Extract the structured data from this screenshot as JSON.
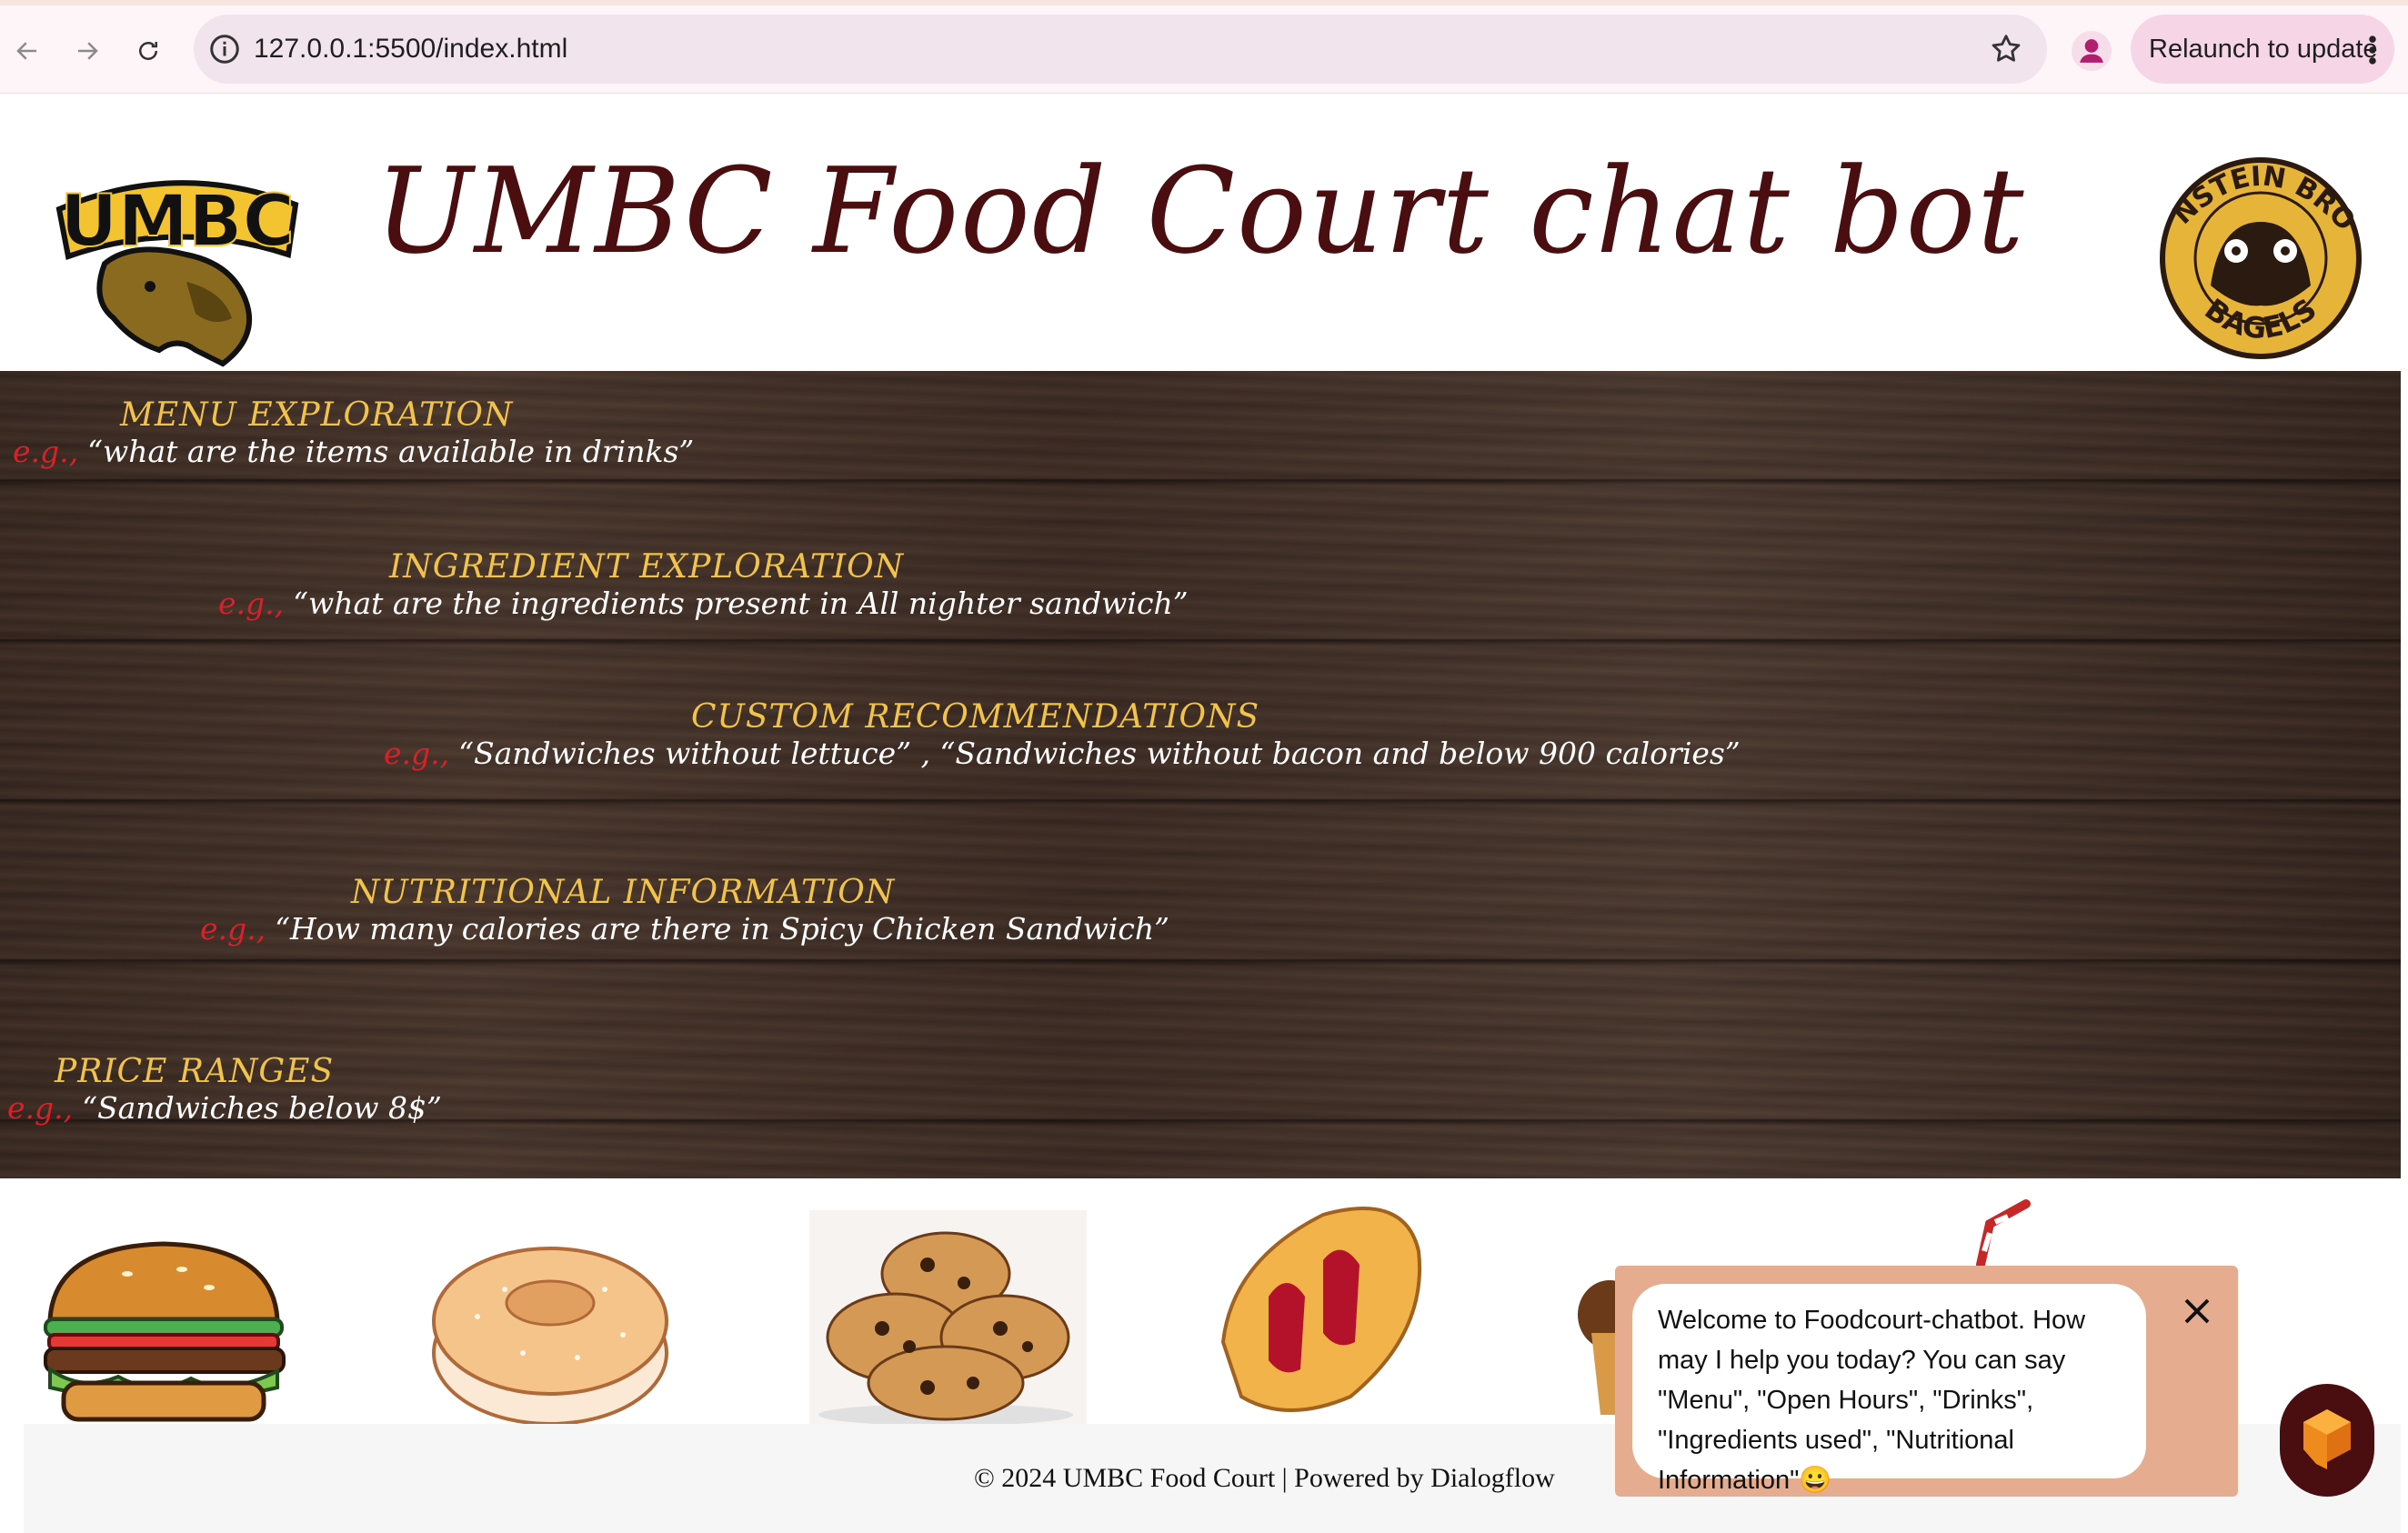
{
  "browser": {
    "url": "127.0.0.1:5500/index.html",
    "relaunch_label": "Relaunch to update",
    "icons": [
      "back-icon",
      "forward-icon",
      "reload-icon",
      "info-icon",
      "star-icon",
      "profile-icon",
      "kebab-menu-icon"
    ]
  },
  "header": {
    "title": "UMBC Food Court chat bot",
    "left_logo_text": "UMBC",
    "right_logo_text_top": "EINSTEIN BROS",
    "right_logo_text_bottom": "BAGELS"
  },
  "features": [
    {
      "title": "MENU EXPLORATION",
      "eg": "e.g.,",
      "example": "“what are the items available in drinks”"
    },
    {
      "title": "INGREDIENT EXPLORATION",
      "eg": "e.g.,",
      "example": "“what are the ingredients present in All nighter sandwich”"
    },
    {
      "title": "CUSTOM RECOMMENDATIONS",
      "eg": "e.g.,",
      "example": "“Sandwiches without lettuce” , “Sandwiches without bacon and below 900 calories”"
    },
    {
      "title": "NUTRITIONAL INFORMATION",
      "eg": "e.g.,",
      "example": "“How many calories are there in Spicy Chicken Sandwich”"
    },
    {
      "title": "PRICE RANGES",
      "eg": "e.g.,",
      "example": "“Sandwiches below 8$”"
    }
  ],
  "foods": [
    "burger-image",
    "bagel-image",
    "cookies-image",
    "pastry-image",
    "muffin-image",
    "drink-straw-image"
  ],
  "footer": {
    "text": "© 2024 UMBC Food Court | Powered by Dialogflow"
  },
  "chat": {
    "message": "Welcome to Foodcourt-chatbot. How may I help you today? You can say \"Menu\", \"Open Hours\", \"Drinks\", \"Ingredients used\", \"Nutritional Information\"😀"
  },
  "colors": {
    "title": "#4a0e10",
    "feature_title": "#f1c34a",
    "eg": "#d9212a",
    "chat_bg": "#e5ac8f",
    "launcher": "#4a0e10"
  }
}
